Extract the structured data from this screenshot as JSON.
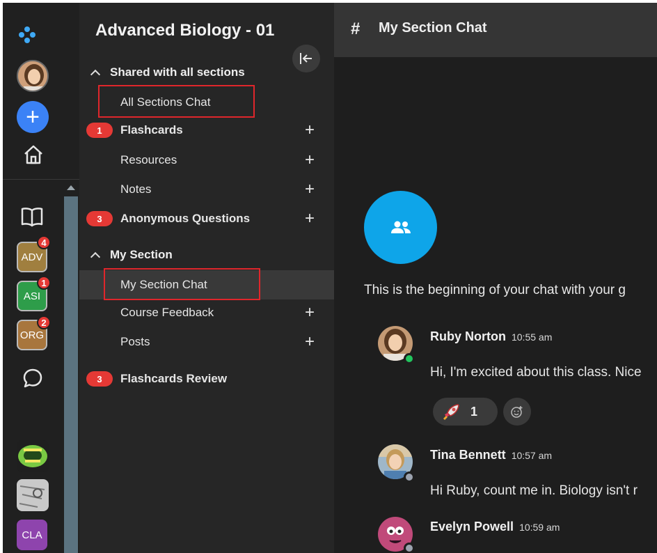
{
  "rail": {
    "courses": [
      {
        "label": "ADV",
        "badge": "4",
        "color": "#a07f3f"
      },
      {
        "label": "ASI",
        "badge": "1",
        "color": "#2e9d4a"
      },
      {
        "label": "ORG",
        "badge": "2",
        "color": "#a8763d"
      }
    ],
    "bottom_course": {
      "label": "CLA",
      "color": "#8e44ad"
    }
  },
  "sidebar": {
    "course_title": "Advanced Biology - 01",
    "shared_section": {
      "title": "Shared with all sections",
      "items": [
        {
          "label": "All Sections Chat"
        },
        {
          "label": "Flashcards",
          "badge": "1"
        },
        {
          "label": "Resources"
        },
        {
          "label": "Notes"
        },
        {
          "label": "Anonymous Questions",
          "badge": "3"
        }
      ]
    },
    "my_section": {
      "title": "My Section",
      "items": [
        {
          "label": "My Section Chat"
        },
        {
          "label": "Course Feedback"
        },
        {
          "label": "Posts"
        }
      ]
    },
    "flashcards_review": {
      "label": "Flashcards Review",
      "badge": "3"
    }
  },
  "main": {
    "channel_prefix": "#",
    "channel_title": "My Section Chat",
    "intro_text": "This is the beginning of your chat with your g",
    "messages": [
      {
        "name": "Ruby Norton",
        "time": "10:55 am",
        "text": "Hi, I'm excited about this class. Nice",
        "status_color": "#22c55e"
      },
      {
        "name": "Tina Bennett",
        "time": "10:57 am",
        "text": "Hi Ruby, count me in. Biology isn't r",
        "status_color": "#9ca3af"
      },
      {
        "name": "Evelyn Powell",
        "time": "10:59 am",
        "text": "",
        "status_color": "#9ca3af"
      }
    ],
    "reaction": {
      "emoji": "rocket-emoji",
      "count": "1"
    }
  },
  "colors": {
    "accent_blue": "#3b82f6",
    "group_cyan": "#0ea5e9",
    "badge_red": "#e53935",
    "highlight_red": "#e0262b"
  }
}
